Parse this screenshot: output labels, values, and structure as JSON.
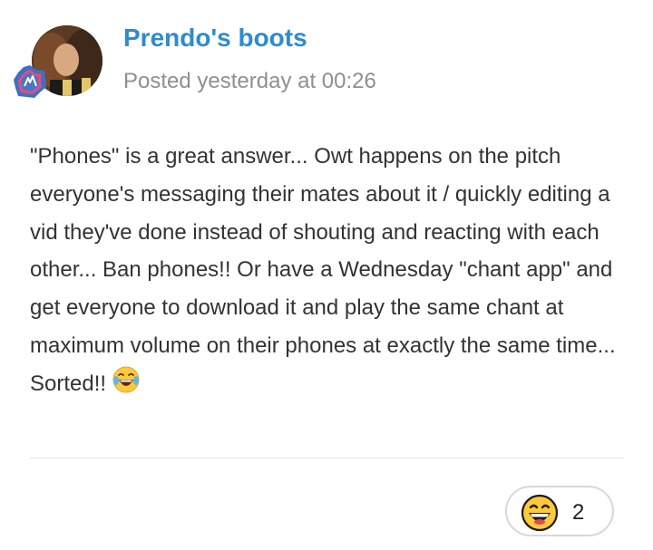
{
  "post": {
    "author_name": "Prendo's boots",
    "posted_prefix": "Posted ",
    "posted_time": "yesterday at 00:26",
    "body_text": "\"Phones\" is a great answer... Owt happens on the pitch everyone's messaging their mates about it / quickly editing a vid they've done instead of shouting and reacting with each other... Ban phones!!  Or have a Wednesday \"chant app\" and get everyone to download it and play the same chant at maximum volume on their phones at exactly the same time... Sorted!!",
    "inline_emoji": "laughing-tears-icon",
    "reaction": {
      "icon": "grinning-face-icon",
      "count": "2"
    }
  },
  "colors": {
    "author": "#2e8bd1",
    "meta": "#8c8f94",
    "body": "#333333",
    "divider": "#e4e4e4",
    "pill_border": "#d8d8d8",
    "badge_outer": "#3f6fc4",
    "badge_inner": "#e0507a",
    "emoji_face": "#ffc93c"
  }
}
